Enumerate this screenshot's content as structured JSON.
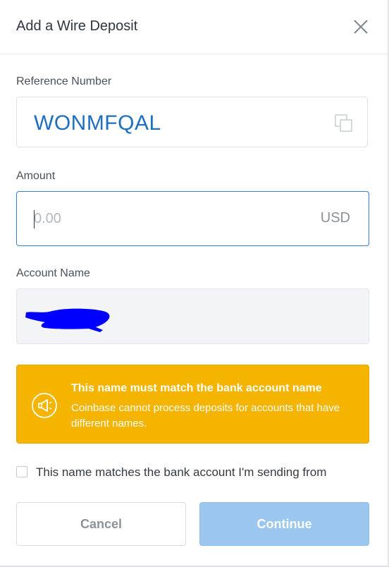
{
  "modal": {
    "title": "Add a Wire Deposit",
    "close_icon": "close-icon"
  },
  "reference": {
    "label": "Reference Number",
    "value": "WONMFQAL",
    "copy_icon": "copy-icon"
  },
  "amount": {
    "label": "Amount",
    "placeholder": "0.00",
    "currency": "USD"
  },
  "account_name": {
    "label": "Account Name",
    "redacted": true
  },
  "warning": {
    "icon": "megaphone-icon",
    "title": "This name must match the bank account name",
    "text": "Coinbase cannot process deposits for accounts that have different names."
  },
  "confirm": {
    "label": "This name matches the bank account I'm sending from",
    "checked": false
  },
  "buttons": {
    "cancel": "Cancel",
    "continue": "Continue"
  },
  "colors": {
    "accent": "#1e6fc2",
    "warning_bg": "#f5b400",
    "continue_disabled": "#9bc7ef"
  }
}
